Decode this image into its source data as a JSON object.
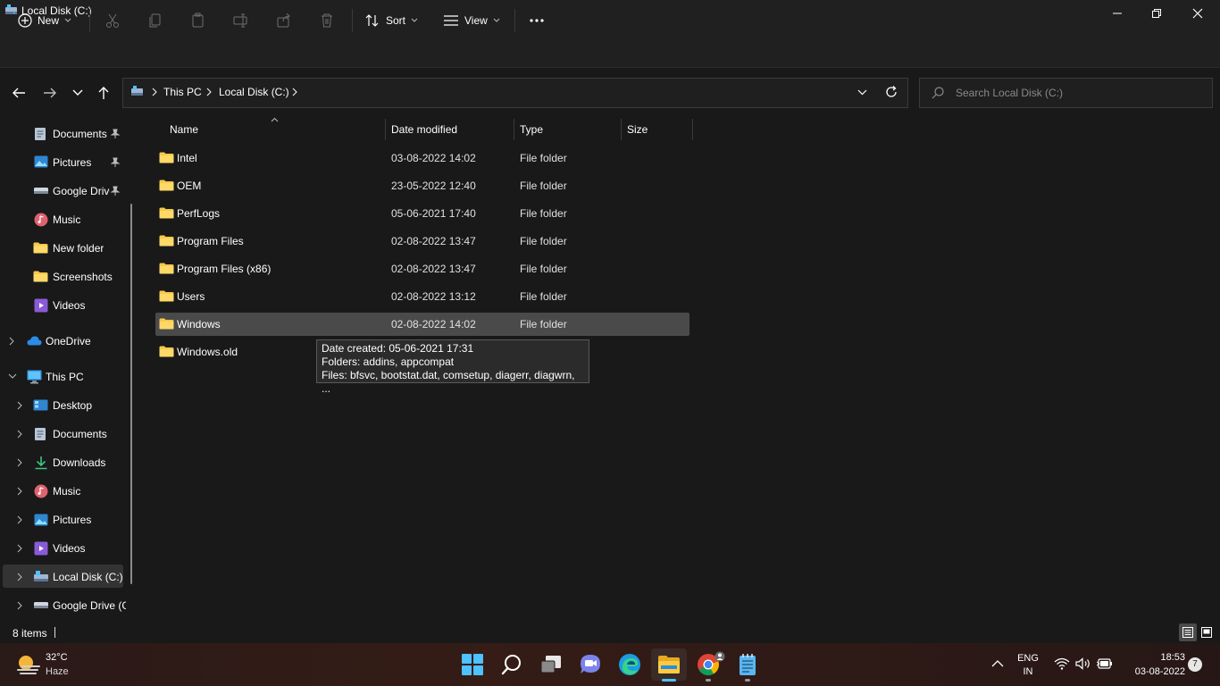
{
  "window": {
    "title": "Local Disk (C:)"
  },
  "commandbar": {
    "new_label": "New",
    "sort_label": "Sort",
    "view_label": "View"
  },
  "address": {
    "crumbs": [
      "This PC",
      "Local Disk (C:)"
    ],
    "search_placeholder": "Search Local Disk (C:)"
  },
  "nav": {
    "quick": [
      {
        "label": "Documents",
        "icon": "documents-icon",
        "pinned": true
      },
      {
        "label": "Pictures",
        "icon": "pictures-icon",
        "pinned": true
      },
      {
        "label": "Google Drive",
        "icon": "drive-icon",
        "pinned": true
      },
      {
        "label": "Music",
        "icon": "music-icon",
        "pinned": false
      },
      {
        "label": "New folder",
        "icon": "folder-icon",
        "pinned": false
      },
      {
        "label": "Screenshots",
        "icon": "folder-icon",
        "pinned": false
      },
      {
        "label": "Videos",
        "icon": "videos-icon",
        "pinned": false
      }
    ],
    "onedrive": "OneDrive",
    "thispc": "This PC",
    "pc_children": [
      {
        "label": "Desktop",
        "icon": "desktop-icon"
      },
      {
        "label": "Documents",
        "icon": "documents-icon"
      },
      {
        "label": "Downloads",
        "icon": "downloads-icon"
      },
      {
        "label": "Music",
        "icon": "music-icon"
      },
      {
        "label": "Pictures",
        "icon": "pictures-icon"
      },
      {
        "label": "Videos",
        "icon": "videos-icon"
      },
      {
        "label": "Local Disk (C:)",
        "icon": "drive-icon"
      },
      {
        "label": "Google Drive (G",
        "icon": "drive-icon"
      }
    ]
  },
  "columns": {
    "name": "Name",
    "date": "Date modified",
    "type": "Type",
    "size": "Size"
  },
  "files": [
    {
      "name": "Intel",
      "date": "03-08-2022 14:02",
      "type": "File folder"
    },
    {
      "name": "OEM",
      "date": "23-05-2022 12:40",
      "type": "File folder"
    },
    {
      "name": "PerfLogs",
      "date": "05-06-2021 17:40",
      "type": "File folder"
    },
    {
      "name": "Program Files",
      "date": "02-08-2022 13:47",
      "type": "File folder"
    },
    {
      "name": "Program Files (x86)",
      "date": "02-08-2022 13:47",
      "type": "File folder"
    },
    {
      "name": "Users",
      "date": "02-08-2022 13:12",
      "type": "File folder"
    },
    {
      "name": "Windows",
      "date": "02-08-2022 14:02",
      "type": "File folder"
    },
    {
      "name": "Windows.old",
      "date": "",
      "type": ""
    }
  ],
  "tooltip": {
    "line1": "Date created: 05-06-2021 17:31",
    "line2": "Folders: addins, appcompat",
    "line3": "Files: bfsvc, bootstat.dat, comsetup, diagerr, diagwrn, ..."
  },
  "status": {
    "item_count": "8 items"
  },
  "taskbar": {
    "weather_temp": "32°C",
    "weather_desc": "Haze",
    "lang": "ENG",
    "region": "IN",
    "time": "18:53",
    "date": "03-08-2022",
    "notifications": "7"
  },
  "colors": {
    "folder": "#f8c84a",
    "accent": "#4cc2ff",
    "selected_row": "#4a4a4a"
  }
}
